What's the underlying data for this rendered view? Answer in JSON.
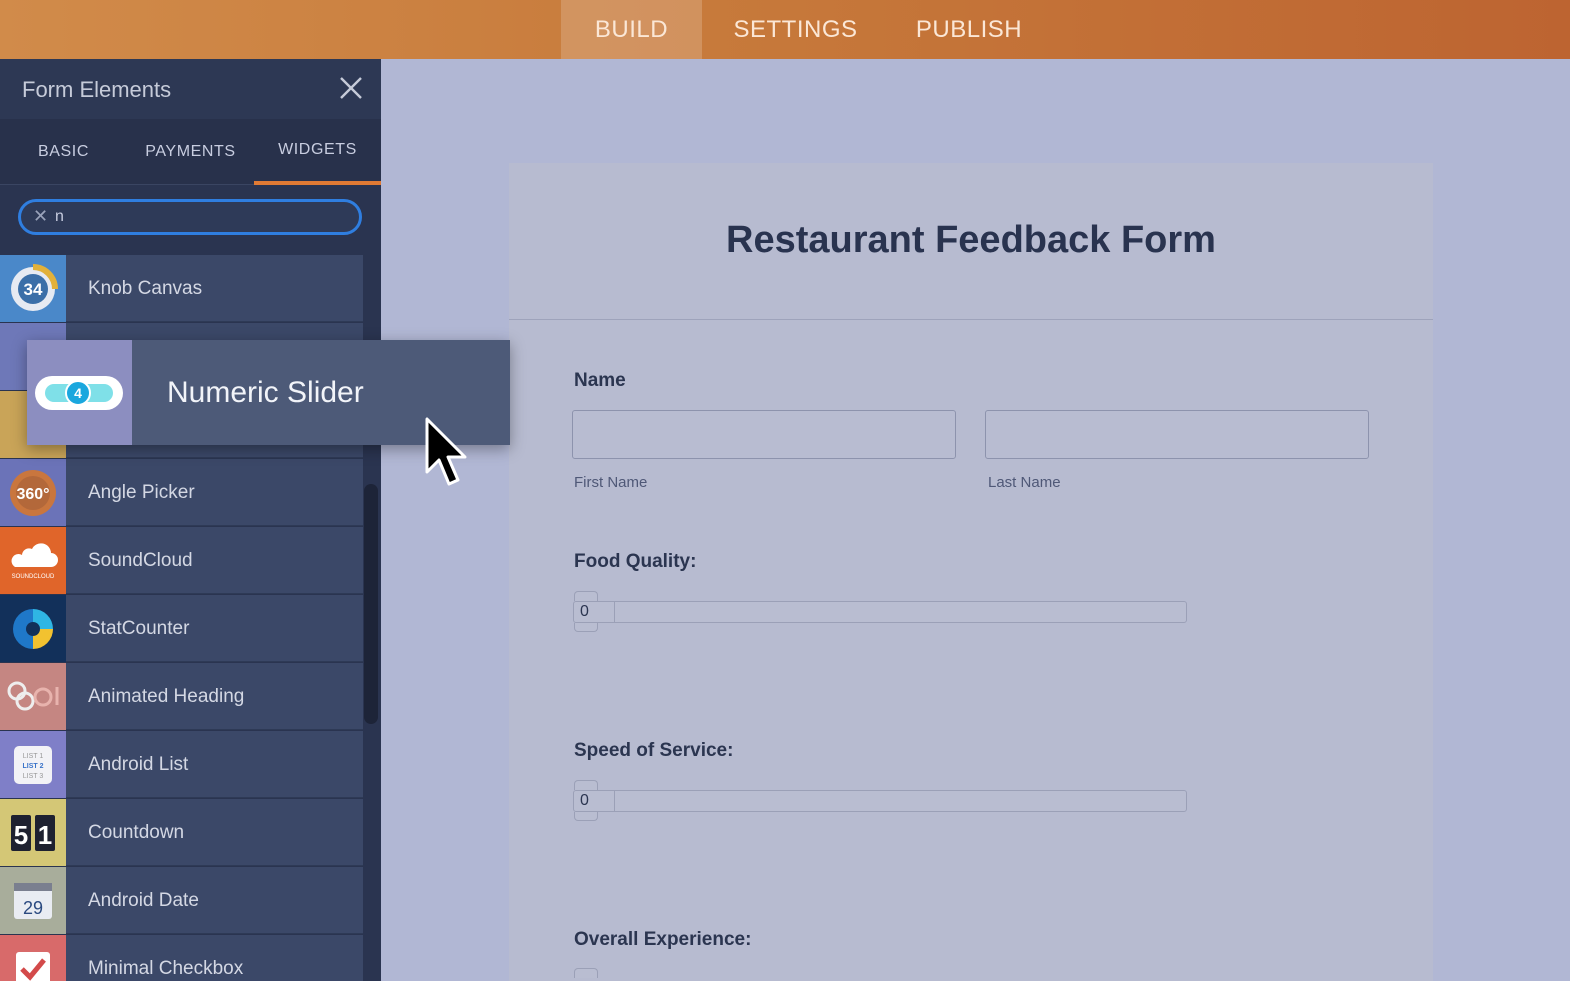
{
  "topnav": {
    "tabs": [
      "BUILD",
      "SETTINGS",
      "PUBLISH"
    ],
    "active": "BUILD"
  },
  "sidebar": {
    "title": "Form Elements",
    "tabs": [
      "BASIC",
      "PAYMENTS",
      "WIDGETS"
    ],
    "active_tab": "WIDGETS",
    "search": {
      "value": "n",
      "clear_icon": "close-icon"
    },
    "items": [
      {
        "label": "Knob Canvas",
        "icon": "knob-icon",
        "color": "#4a88c9"
      },
      {
        "label": "",
        "icon": "slider-icon",
        "color": "#6e78b8"
      },
      {
        "label": "",
        "icon": "cart-icon",
        "color": "#c9a458"
      },
      {
        "label": "Angle Picker",
        "icon": "angle-icon",
        "color": "#6b73b8"
      },
      {
        "label": "SoundCloud",
        "icon": "soundcloud-icon",
        "color": "#e0652a"
      },
      {
        "label": "StatCounter",
        "icon": "statcounter-icon",
        "color": "#12305a"
      },
      {
        "label": "Animated Heading",
        "icon": "animated-heading-icon",
        "color": "#c58682"
      },
      {
        "label": "Android List",
        "icon": "android-list-icon",
        "color": "#7f7fc8"
      },
      {
        "label": "Countdown",
        "icon": "countdown-icon",
        "color": "#d4c776"
      },
      {
        "label": "Android Date",
        "icon": "android-date-icon",
        "color": "#a8ad9b"
      },
      {
        "label": "Minimal Checkbox",
        "icon": "checkbox-icon",
        "color": "#d86a6a"
      }
    ]
  },
  "drag": {
    "label": "Numeric Slider",
    "knob_value": "4"
  },
  "form": {
    "title": "Restaurant Feedback Form",
    "name_label": "Name",
    "first_name": "First Name",
    "last_name": "Last Name",
    "food_quality": {
      "label": "Food Quality:",
      "value": "0"
    },
    "speed": {
      "label": "Speed of Service:",
      "value": "0"
    },
    "overall": {
      "label": "Overall Experience:"
    }
  }
}
